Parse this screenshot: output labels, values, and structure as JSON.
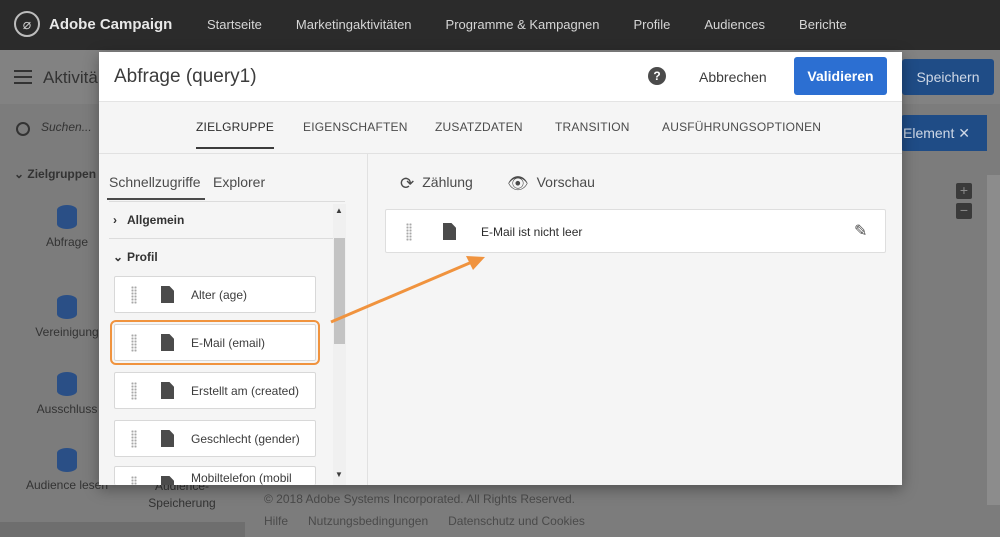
{
  "app": {
    "name": "Adobe Campaign",
    "logo_glyph": "⌀"
  },
  "topnav": [
    "Startseite",
    "Marketingaktivitäten",
    "Programme & Kampagnen",
    "Profile",
    "Audiences",
    "Berichte"
  ],
  "background": {
    "title": "Aktivitä",
    "save_label": "Speichern",
    "element_label": "Element ✕",
    "search_placeholder": "Suchen...",
    "group_label": "Zielgruppen",
    "items": [
      "Abfrage",
      "Vereinigung",
      "Ausschluss",
      "Audience lesen",
      "Audience-\nSpeicherung"
    ],
    "footer_copyright": "© 2018 Adobe Systems Incorporated. All Rights Reserved.",
    "footer_links": [
      "Hilfe",
      "Nutzungsbedingungen",
      "Datenschutz und Cookies"
    ]
  },
  "modal": {
    "title": "Abfrage (query1)",
    "help_glyph": "?",
    "cancel_label": "Abbrechen",
    "validate_label": "Validieren",
    "tabs": [
      "ZIELGRUPPE",
      "EIGENSCHAFTEN",
      "ZUSATZDATEN",
      "TRANSITION",
      "AUSFÜHRUNGSOPTIONEN"
    ],
    "active_tab": "ZIELGRUPPE",
    "left_panel": {
      "tabs": [
        "Schnellzugriffe",
        "Explorer"
      ],
      "active_tab": "Schnellzugriffe",
      "sections": [
        {
          "label": "Allgemein",
          "expanded": false
        },
        {
          "label": "Profil",
          "expanded": true
        }
      ],
      "fields": [
        "Alter (age)",
        "E-Mail (email)",
        "Erstellt am (created)",
        "Geschlecht (gender)",
        "Mobiltelefon (mobil"
      ],
      "highlighted_field": "E-Mail (email)"
    },
    "right_panel": {
      "count_label": "Zählung",
      "preview_label": "Vorschau",
      "condition": "E-Mail ist nicht leer"
    }
  },
  "colors": {
    "accent": "#2c6fd2",
    "highlight": "#f0933e",
    "topbar": "#2b2b2b"
  }
}
